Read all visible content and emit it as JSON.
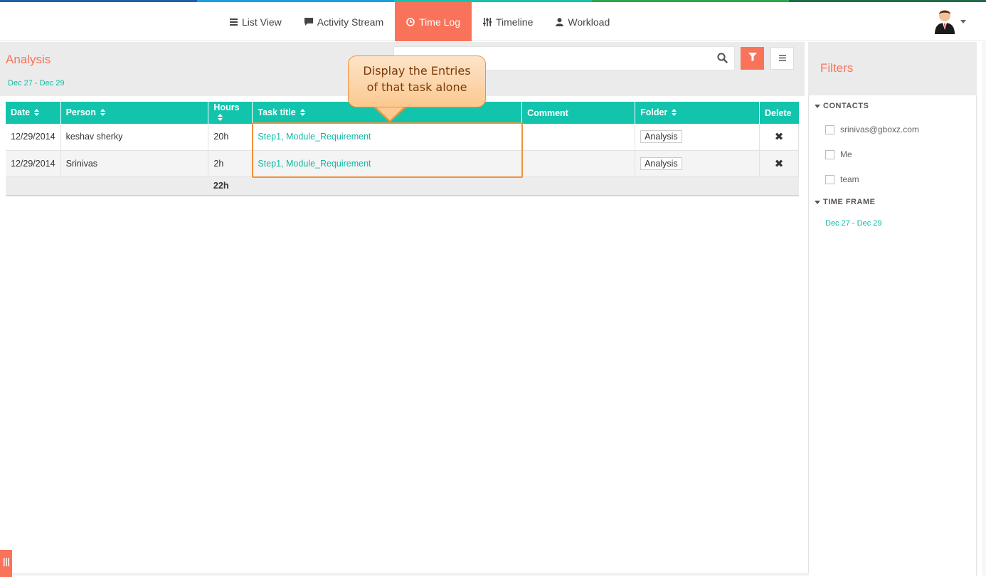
{
  "colors": {
    "accent": "#f9735b",
    "teal": "#13c4ad",
    "stripe": [
      "#1f5fa8",
      "#1aa0dc",
      "#13c4ad",
      "#2aa84a",
      "#1f7a4a"
    ]
  },
  "nav": {
    "items": [
      {
        "label": "List View",
        "icon": "list-icon"
      },
      {
        "label": "Activity Stream",
        "icon": "comment-icon"
      },
      {
        "label": "Time Log",
        "icon": "clock-icon",
        "active": true
      },
      {
        "label": "Timeline",
        "icon": "sliders-icon"
      },
      {
        "label": "Workload",
        "icon": "user-icon"
      }
    ]
  },
  "header": {
    "title": "Analysis",
    "date_range": "Dec 27  -  Dec 29"
  },
  "table": {
    "columns": [
      "Date",
      "Person",
      "Hours",
      "Task title",
      "Comment",
      "Folder",
      "Delete"
    ],
    "rows": [
      {
        "date": "12/29/2014",
        "person": "keshav sherky",
        "hours": "20h",
        "task": "Step1, Module_Requirement",
        "comment": "",
        "folder": "Analysis",
        "delete": "✖"
      },
      {
        "date": "12/29/2014",
        "person": "Srinivas",
        "hours": "2h",
        "task": "Step1, Module_Requirement",
        "comment": "",
        "folder": "Analysis",
        "delete": "✖"
      }
    ],
    "total_hours": "22h"
  },
  "callout": {
    "line1": "Display the Entries",
    "line2": "of that task alone"
  },
  "sidebar": {
    "title": "Filters",
    "contacts_label": "CONTACTS",
    "contacts": [
      "srinivas@gboxz.com",
      "Me",
      "team"
    ],
    "timeframe_label": "TIME FRAME",
    "timeframe_range": "Dec 27  -  Dec 29"
  }
}
